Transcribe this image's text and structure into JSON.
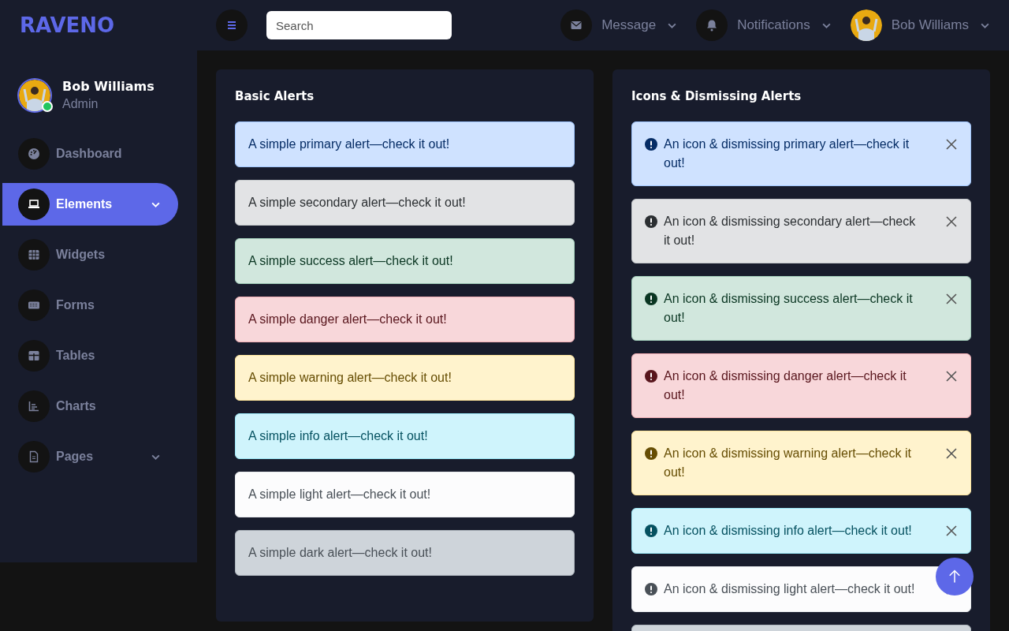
{
  "brand": "RAVENO",
  "user": {
    "name": "Bob Williams",
    "role": "Admin",
    "online": true
  },
  "nav": [
    {
      "label": "Dashboard",
      "kind": "gauge",
      "selected": false,
      "has_submenu": false
    },
    {
      "label": "Elements",
      "kind": "laptop",
      "selected": true,
      "has_submenu": true
    },
    {
      "label": "Widgets",
      "kind": "grid",
      "selected": false,
      "has_submenu": false
    },
    {
      "label": "Forms",
      "kind": "keyboard",
      "selected": false,
      "has_submenu": false
    },
    {
      "label": "Tables",
      "kind": "table",
      "selected": false,
      "has_submenu": false
    },
    {
      "label": "Charts",
      "kind": "chart",
      "selected": false,
      "has_submenu": false
    },
    {
      "label": "Pages",
      "kind": "file",
      "selected": false,
      "has_submenu": true
    }
  ],
  "topbar": {
    "search": {
      "placeholder": "Search"
    },
    "menus": [
      {
        "kind": "message",
        "label": "Message"
      },
      {
        "kind": "bell",
        "label": "Notifications"
      },
      {
        "kind": "avatar",
        "label": "Bob Williams"
      }
    ]
  },
  "cards": [
    {
      "title": "Basic Alerts",
      "dismissible": false,
      "alerts": [
        {
          "kind": "primary",
          "text": "A simple primary alert—check it out!"
        },
        {
          "kind": "secondary",
          "text": "A simple secondary alert—check it out!"
        },
        {
          "kind": "success",
          "text": "A simple success alert—check it out!"
        },
        {
          "kind": "danger",
          "text": "A simple danger alert—check it out!"
        },
        {
          "kind": "warning",
          "text": "A simple warning alert—check it out!"
        },
        {
          "kind": "info",
          "text": "A simple info alert—check it out!"
        },
        {
          "kind": "light",
          "text": "A simple light alert—check it out!"
        },
        {
          "kind": "dark",
          "text": "A simple dark alert—check it out!"
        }
      ]
    },
    {
      "title": "Icons & Dismissing Alerts",
      "dismissible": true,
      "alerts": [
        {
          "kind": "primary",
          "text": "An icon & dismissing primary alert—check it out!"
        },
        {
          "kind": "secondary",
          "text": "An icon & dismissing secondary alert—check it out!"
        },
        {
          "kind": "success",
          "text": "An icon & dismissing success alert—check it out!"
        },
        {
          "kind": "danger",
          "text": "An icon & dismissing danger alert—check it out!"
        },
        {
          "kind": "warning",
          "text": "An icon & dismissing warning alert—check it out!"
        },
        {
          "kind": "info",
          "text": "An icon & dismissing info alert—check it out!"
        },
        {
          "kind": "light",
          "text": "An icon & dismissing light alert—check it out!"
        },
        {
          "kind": "dark"
        }
      ]
    }
  ],
  "scroll_top": {
    "visible": true
  }
}
